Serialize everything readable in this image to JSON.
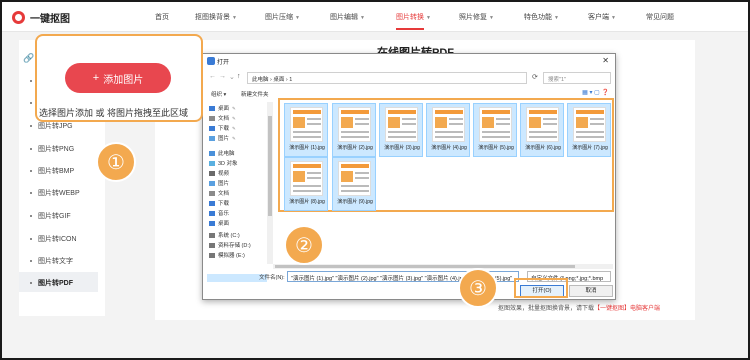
{
  "header": {
    "logo_text": "一键抠图",
    "nav": [
      "首页",
      "抠图换背景",
      "图片压缩",
      "图片编辑",
      "图片转换",
      "照片修复",
      "特色功能",
      "客户端",
      "常见问题"
    ],
    "active_nav": "图片转换"
  },
  "sidebar": {
    "icon": "link-icon",
    "items": [
      "图片转JPG",
      "图片转PNG",
      "图片转BMP",
      "图片转WEBP",
      "图片转GIF",
      "图片转ICON",
      "图片转文字",
      "图片转PDF"
    ],
    "active": "图片转PDF"
  },
  "main": {
    "title": "在线图片转PDF",
    "bottom_text": "抠图效果，批量抠图换背景，请下载",
    "bottom_link": "【一键抠图】电脑客户端"
  },
  "upload": {
    "button_label": "添加图片",
    "hint": "选择图片添加 或 将图片拖拽至此区域"
  },
  "steps": [
    "①",
    "②",
    "③"
  ],
  "dialog": {
    "title": "打开",
    "path": "此电脑 › 桌面 › 1",
    "search_placeholder": "搜索\"1\"",
    "organize": "组织 ▾",
    "new_folder": "新建文件夹",
    "nav_items": [
      {
        "label": "桌面",
        "pinned": true
      },
      {
        "label": "文档",
        "pinned": true
      },
      {
        "label": "下载",
        "pinned": true
      },
      {
        "label": "图片",
        "pinned": true
      },
      {
        "label": "此电脑",
        "pinned": false
      },
      {
        "label": "3D 对象",
        "pinned": false
      },
      {
        "label": "视频",
        "pinned": false
      },
      {
        "label": "图片",
        "pinned": false
      },
      {
        "label": "文档",
        "pinned": false
      },
      {
        "label": "下载",
        "pinned": false
      },
      {
        "label": "音乐",
        "pinned": false
      },
      {
        "label": "桌面",
        "pinned": false
      },
      {
        "label": "系统 (C:)",
        "pinned": false
      },
      {
        "label": "资料存储 (D:)",
        "pinned": false
      },
      {
        "label": "模拟器 (E:)",
        "pinned": false
      }
    ],
    "files": [
      "演示图片 (1).jpg",
      "演示图片 (2).jpg",
      "演示图片 (3).jpg",
      "演示图片 (4).jpg",
      "演示图片 (5).jpg",
      "演示图片 (6).jpg",
      "演示图片 (7).jpg",
      "演示图片 (8).jpg",
      "演示图片 (9).jpg"
    ],
    "filename_label": "文件名(N):",
    "filename_value": "\"演示图片 (1).jpg\" \"演示图片 (2).jpg\" \"演示图片 (3).jpg\" \"演示图片 (4).jpg\" \"演示图片 (5).jpg\"",
    "filetype_value": "自定义文件 (*.png;*.jpg;*.bmp",
    "open_label": "打开(O)",
    "cancel_label": "取消"
  }
}
